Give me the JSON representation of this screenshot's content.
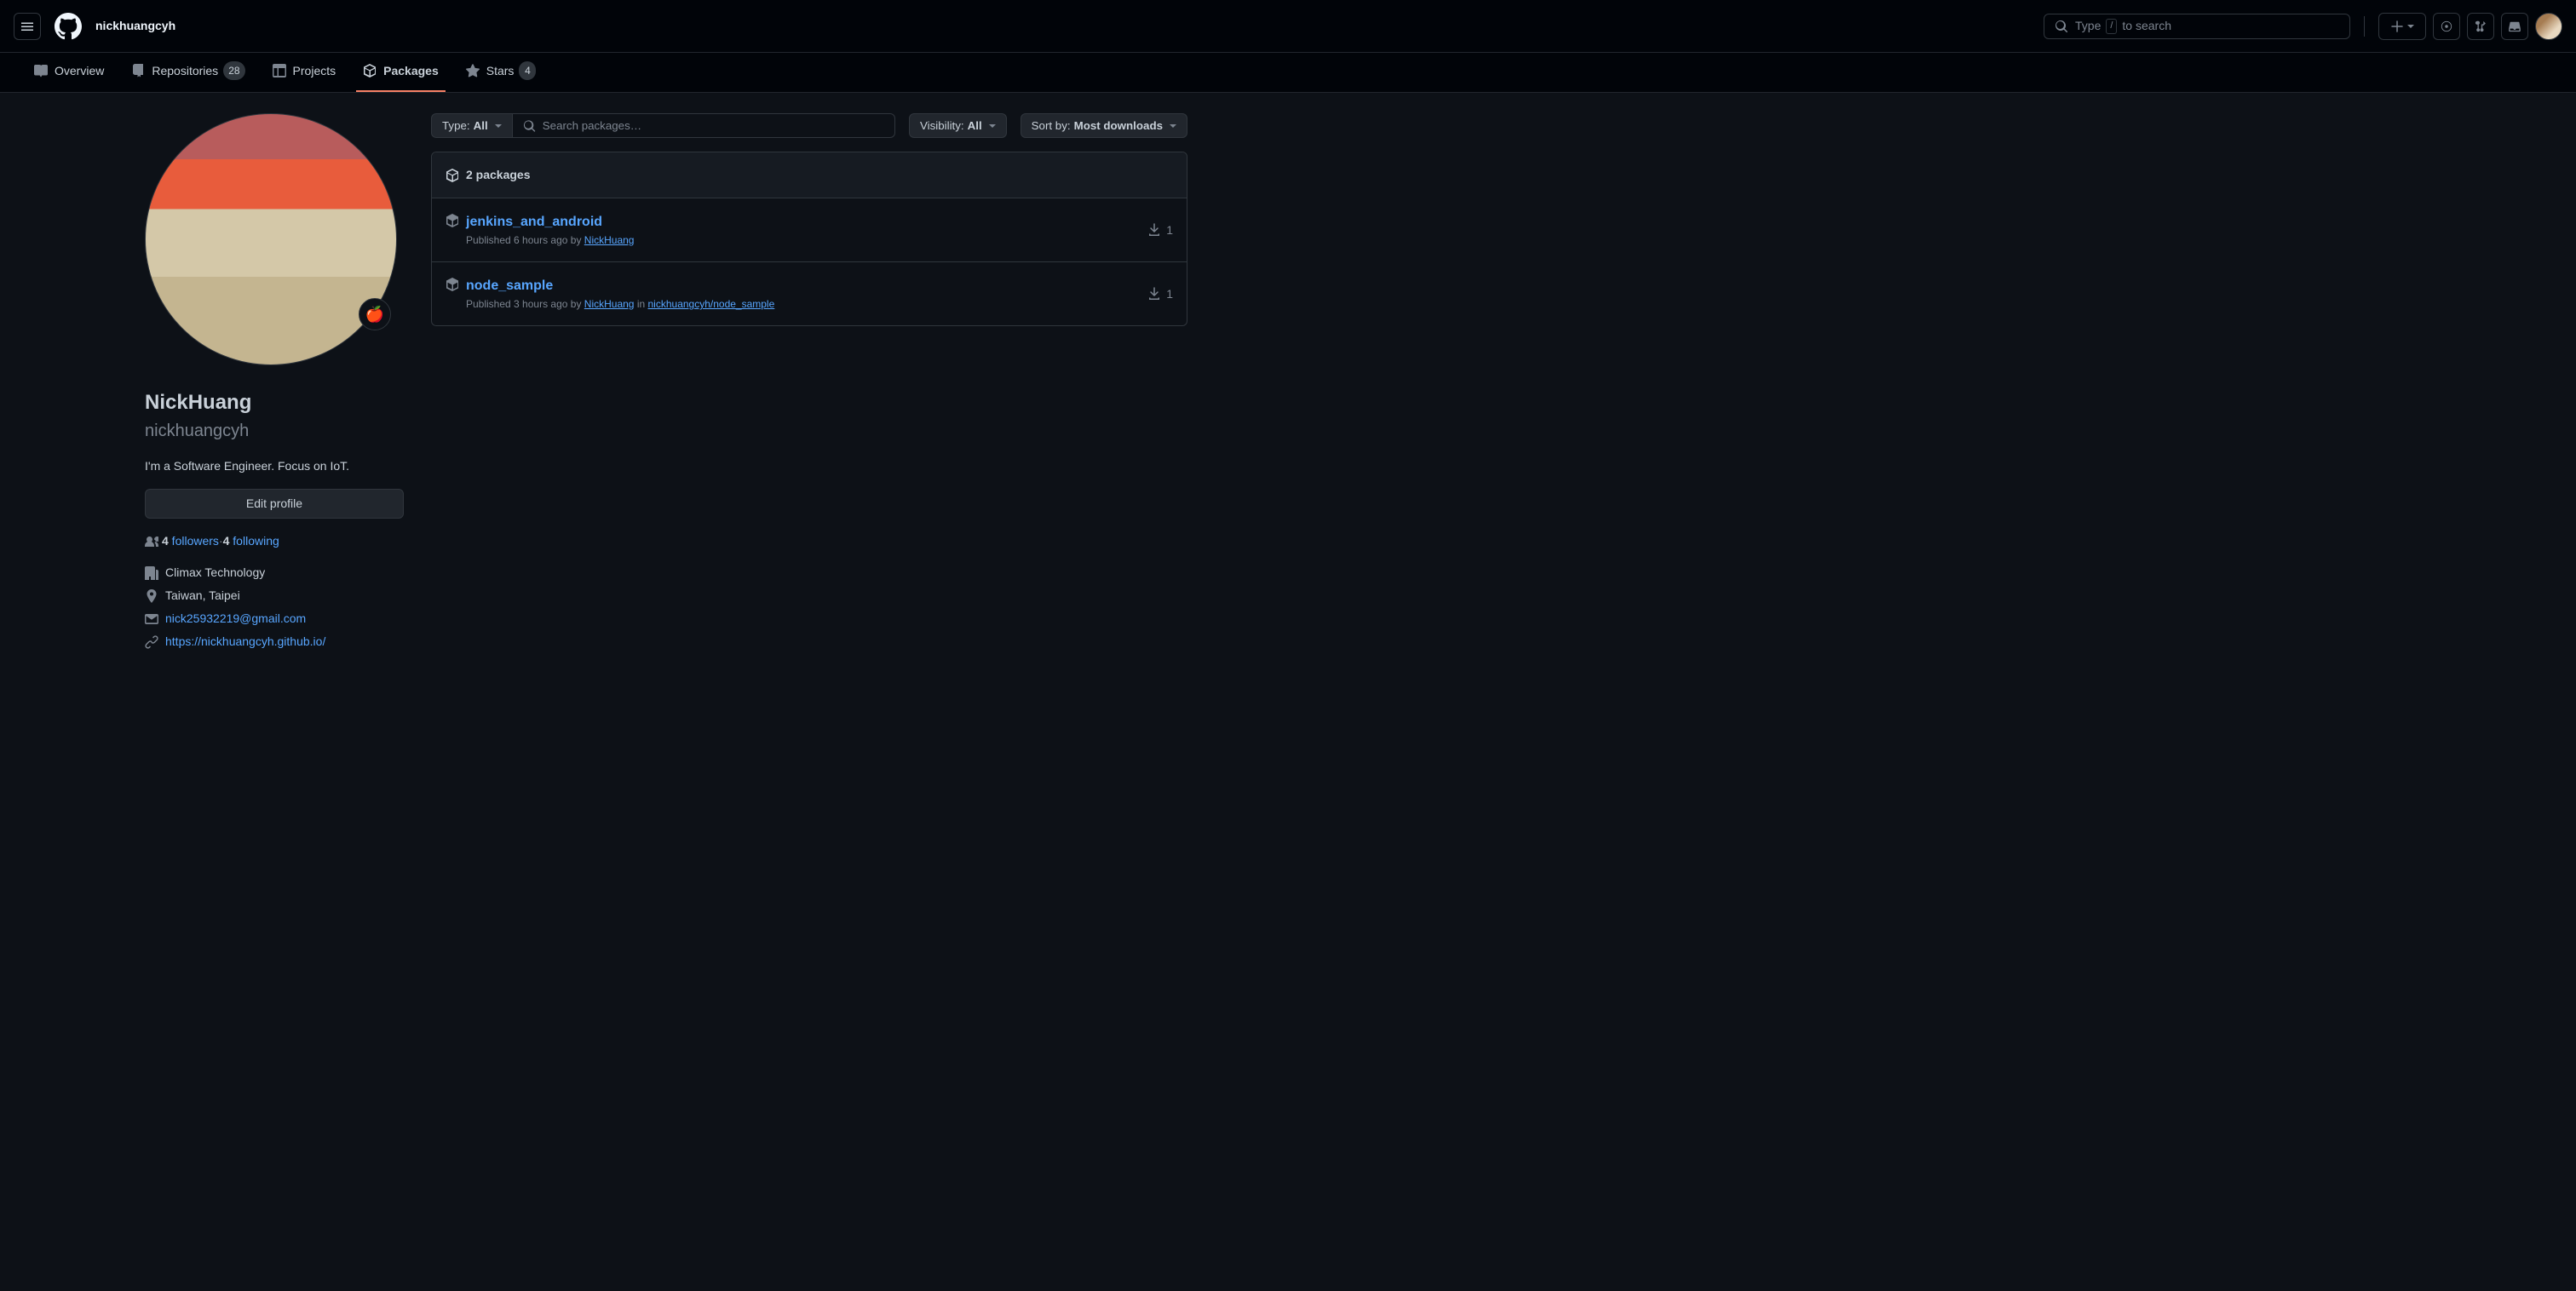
{
  "header": {
    "username": "nickhuangcyh",
    "search_type": "Type",
    "slash": "/",
    "search_suffix": "to search"
  },
  "nav": {
    "overview": "Overview",
    "repositories": "Repositories",
    "repo_count": "28",
    "projects": "Projects",
    "packages": "Packages",
    "stars": "Stars",
    "stars_count": "4"
  },
  "profile": {
    "status_emoji": "🍎",
    "display_name": "NickHuang",
    "username": "nickhuangcyh",
    "bio": "I'm a Software Engineer. Focus on IoT.",
    "edit_button": "Edit profile",
    "followers_count": "4",
    "followers_label": " followers",
    "sep": " · ",
    "following_count": "4",
    "following_label": " following",
    "company": "Climax Technology",
    "location": "Taiwan, Taipei",
    "email": "nick25932219@gmail.com",
    "website": "https://nickhuangcyh.github.io/"
  },
  "filters": {
    "type_prefix": "Type: ",
    "type_value": "All",
    "search_placeholder": "Search packages…",
    "visibility_prefix": "Visibility: ",
    "visibility_value": "All",
    "sort_prefix": "Sort by: ",
    "sort_value": "Most downloads"
  },
  "packages": {
    "count_text": "2 packages",
    "items": [
      {
        "name": "jenkins_and_android",
        "pub_prefix": "Published ",
        "time": "6 hours ago",
        "by": " by ",
        "author": "NickHuang",
        "repo_prefix": "",
        "repo": "",
        "downloads": "1"
      },
      {
        "name": "node_sample",
        "pub_prefix": "Published ",
        "time": "3 hours ago",
        "by": " by ",
        "author": "NickHuang",
        "repo_prefix": " in ",
        "repo": "nickhuangcyh/node_sample",
        "downloads": "1"
      }
    ]
  }
}
